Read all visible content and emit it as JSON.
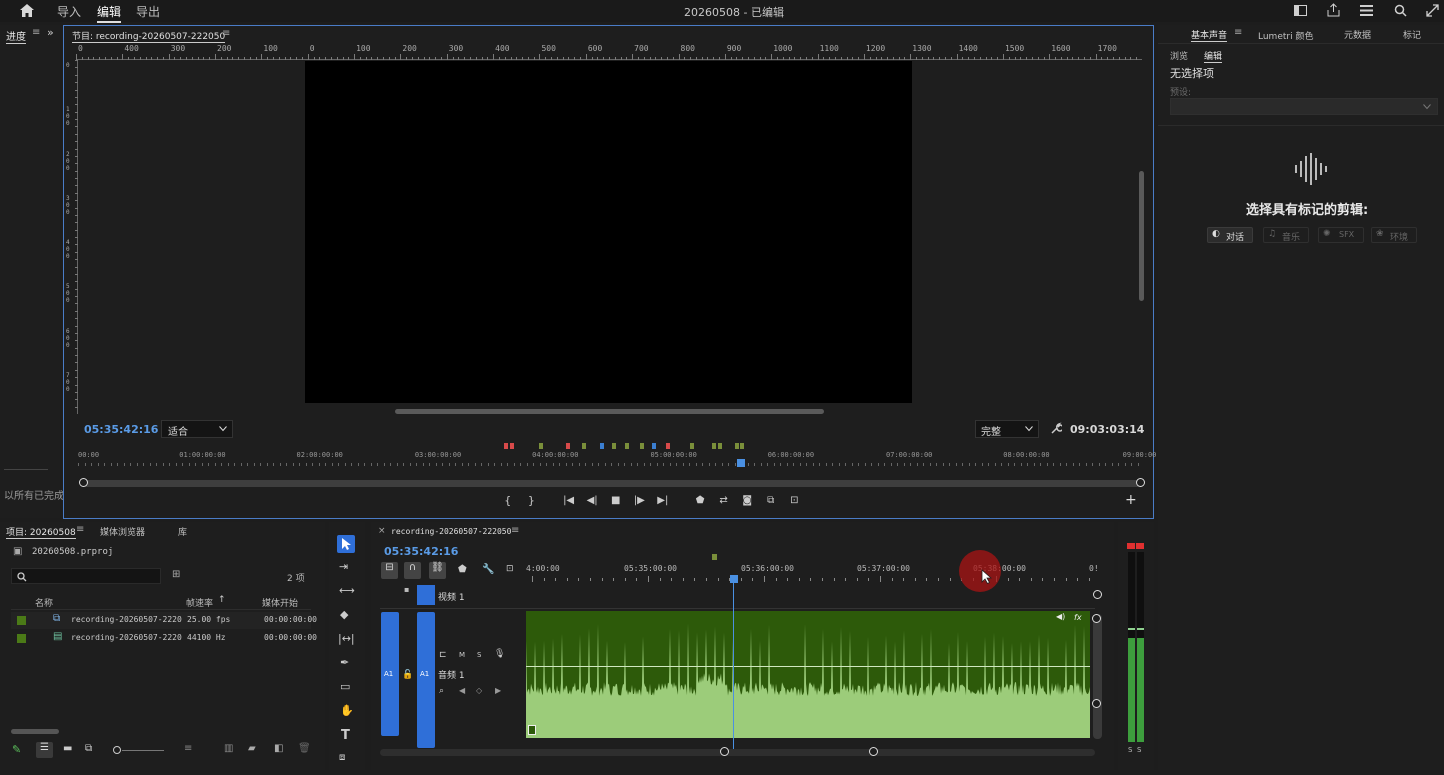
{
  "menubar": {
    "home_icon": "home-icon",
    "items": [
      "导入",
      "编辑",
      "导出"
    ],
    "active": "编辑",
    "doc_title": "20260508 - 已编辑",
    "right_icons": [
      "panel-icon",
      "share-icon",
      "menu-icon",
      "search-icon",
      "fullscreen-icon"
    ]
  },
  "left_strip": {
    "tab": "进度",
    "menu_icon": "menu-icon",
    "more_icon": "double-chevron-icon",
    "status": "以所有已完成"
  },
  "program_monitor": {
    "tab": "节目: recording-20260507-222050",
    "ruler_labels": [
      "0",
      "400",
      "300",
      "200",
      "100",
      "0",
      "100",
      "200",
      "300",
      "400",
      "500",
      "600",
      "700",
      "800",
      "900",
      "1000",
      "1100",
      "1200",
      "1300",
      "1400",
      "1500",
      "1600",
      "1700"
    ],
    "vruler_labels": [
      "0",
      "1 0 0",
      "2 0 0",
      "3 0 0",
      "4 0 0",
      "5 0 0",
      "6 0 0",
      "7 0 0"
    ],
    "timecode": "05:35:42:16",
    "fit_value": "适合",
    "quality_value": "完整",
    "duration": "09:03:03:14",
    "timeline_labels": [
      "00:00",
      "01:00:00:00",
      "02:00:00:00",
      "03:00:00:00",
      "04:00:00:00",
      "05:00:00:00",
      "06:00:00:00",
      "07:00:00:00",
      "08:00:00:00",
      "09:00:00"
    ],
    "playhead_fraction": 0.618,
    "transport_icons": [
      "mark-in-icon",
      "mark-out-icon",
      "go-to-in-icon",
      "step-back-icon",
      "stop-icon",
      "step-forward-icon",
      "go-to-out-icon",
      "add-marker-icon",
      "lift-icon",
      "export-frame-icon",
      "comparison-icon",
      "extract-icon"
    ],
    "add_icon": "plus-icon"
  },
  "right_panel": {
    "tabs": [
      "基本声音",
      "Lumetri 颜色",
      "元数据",
      "标记"
    ],
    "sub_tabs": [
      "浏览",
      "编辑"
    ],
    "active_sub_tab": "编辑",
    "no_selection": "无选择项",
    "preset_label": "预设:",
    "prompt": "选择具有标记的剪辑:",
    "types": [
      "对话",
      "音乐",
      "SFX",
      "环境"
    ]
  },
  "project_panel": {
    "tabs": [
      "项目: 20260508",
      "媒体浏览器",
      "库"
    ],
    "project_file": "20260508.prproj",
    "search_placeholder": "",
    "item_count": "2 项",
    "columns": [
      "名称",
      "帧速率",
      "媒体开始"
    ],
    "rows": [
      {
        "name": "recording-20260507-2220",
        "fps": "25.00 fps",
        "start": "00:00:00:00",
        "color": "#4b7a17"
      },
      {
        "name": "recording-20260507-2220",
        "fps": "44100 Hz",
        "start": "00:00:00:00",
        "color": "#4b7a17"
      }
    ]
  },
  "timeline": {
    "tab": "recording-20260507-222050",
    "timecode": "05:35:42:16",
    "ruler_labels": [
      "4:00:00",
      "05:35:00:00",
      "05:36:00:00",
      "05:37:00:00",
      "05:38:00:00",
      "0!"
    ],
    "video_track": "视频 1",
    "v1": "V1",
    "audio_track": "音频 1",
    "a1": "A1",
    "m": "M",
    "s": "S",
    "clip_fx": "fx",
    "clip_color": "#2d5a0a",
    "wave_color": "#9ccc7a"
  },
  "meter": {
    "labels": [
      "S",
      "S"
    ]
  }
}
